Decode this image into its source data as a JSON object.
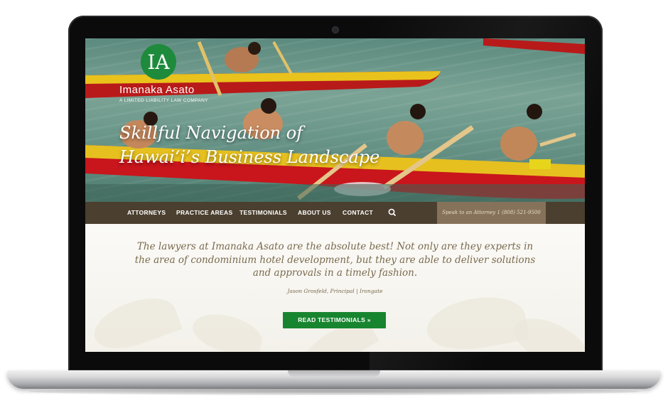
{
  "brand": {
    "logo_monogram": "IA",
    "name": "Imanaka Asato",
    "tagline": "A LIMITED LIABILITY LAW COMPANY",
    "color": "#1e8a3c"
  },
  "hero": {
    "title_line1": "Skillful Navigation of",
    "title_line2": "Hawaiʻi’s Business Landscape"
  },
  "nav": {
    "items": [
      "ATTORNEYS",
      "PRACTICE AREAS",
      "TESTIMONIALS",
      "ABOUT US",
      "CONTACT"
    ],
    "search_icon": "search-icon",
    "cta": "Speak to an Attorney 1 (808) 521-9500",
    "background": "#4b3f2f"
  },
  "testimonial": {
    "quote": "The lawyers at Imanaka Asato are the absolute best! Not only are they experts in the area of condominium hotel development, but they are able to deliver solutions and approvals in a timely fashion.",
    "attribution": "Jason Grosfeld, Principal | Irongate",
    "button": "READ TESTIMONIALS »",
    "button_color": "#17852f"
  }
}
